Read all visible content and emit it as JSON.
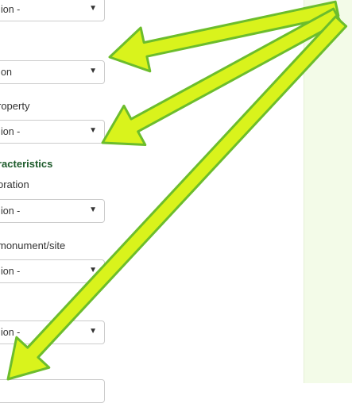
{
  "form": {
    "select_0_value": "ion -",
    "select_1_value": "on",
    "label_property": "roperty",
    "select_2_value": "ion -",
    "heading_characteristics": "racteristics",
    "label_decoration": "oration",
    "select_3_value": "ion -",
    "label_monument_site": "monument/site",
    "select_4_value": "ion -",
    "select_5_value": "ion -",
    "caret_glyph": "▼"
  },
  "colors": {
    "arrow_fill": "#d9f31c",
    "arrow_outline": "#6cbd2c",
    "panel_background": "#f3fbe8",
    "heading_color": "#1d5b2b"
  }
}
